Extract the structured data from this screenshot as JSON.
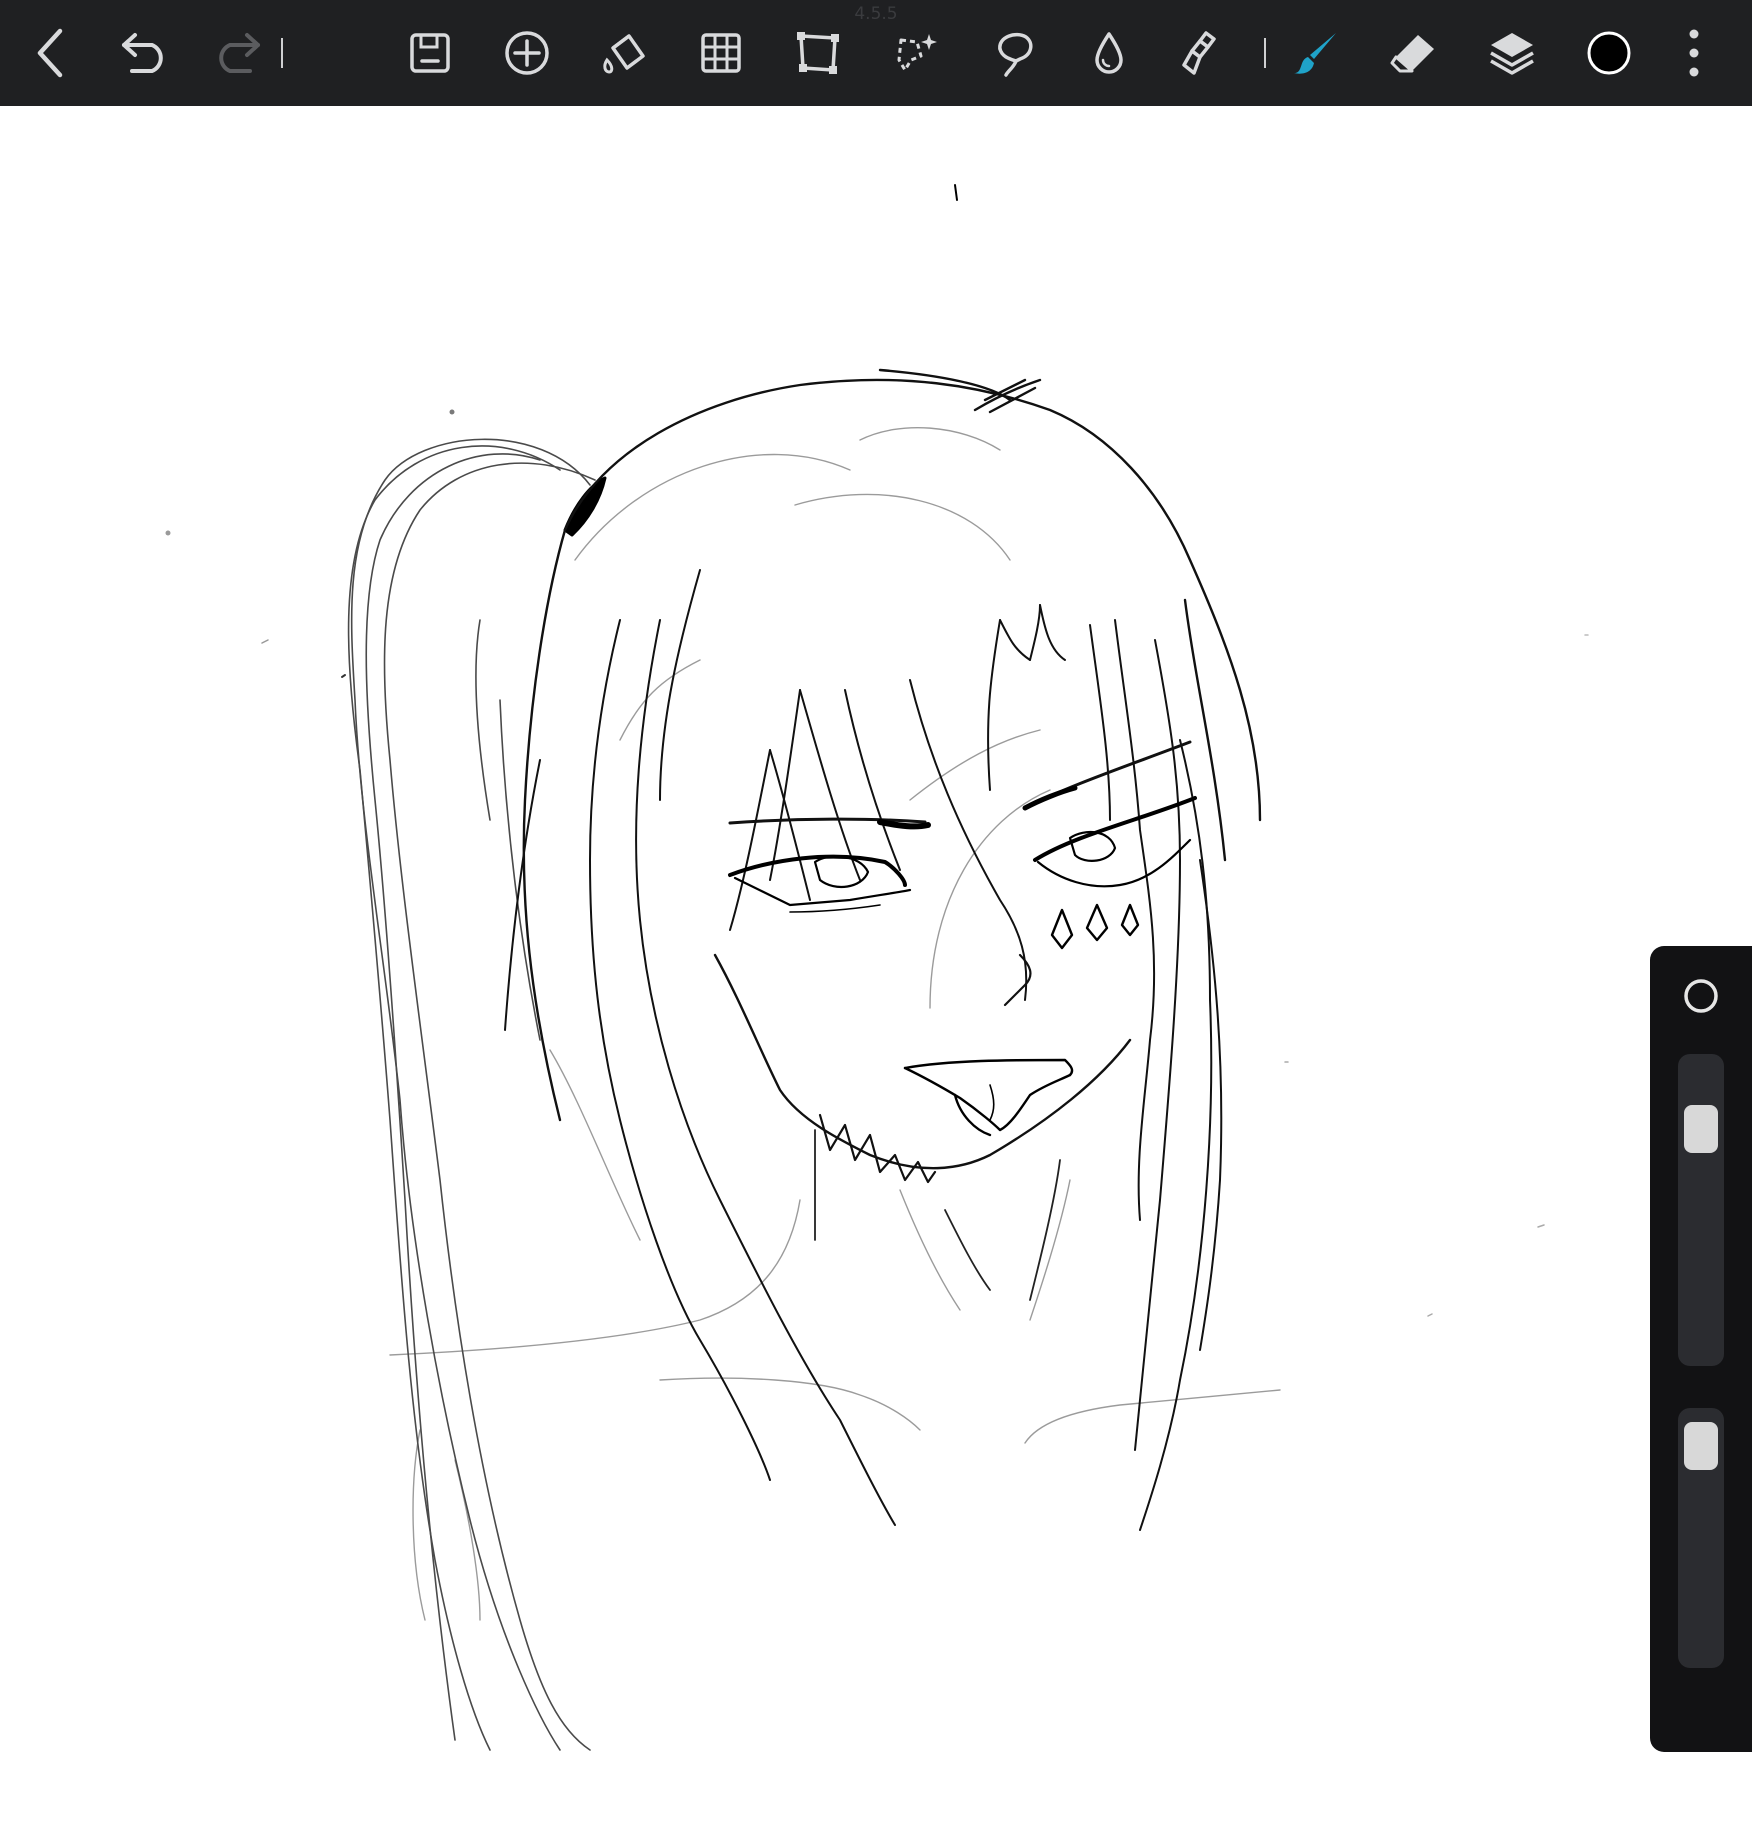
{
  "app": {
    "version": "4.5.5"
  },
  "toolbar": {
    "left_tools": [
      {
        "name": "back",
        "icon": "chevron-left-icon"
      },
      {
        "name": "undo",
        "icon": "undo-icon"
      },
      {
        "name": "redo",
        "icon": "redo-icon",
        "disabled": true
      }
    ],
    "center_tools": [
      {
        "name": "save",
        "icon": "save-icon"
      },
      {
        "name": "add",
        "icon": "add-circle-icon"
      },
      {
        "name": "fill",
        "icon": "paint-bucket-icon"
      },
      {
        "name": "grid",
        "icon": "grid-icon"
      },
      {
        "name": "transform",
        "icon": "transform-icon"
      },
      {
        "name": "magic-select",
        "icon": "magic-wand-icon"
      },
      {
        "name": "lasso",
        "icon": "lasso-icon"
      },
      {
        "name": "blur",
        "icon": "water-drop-icon"
      },
      {
        "name": "smudge",
        "icon": "smudge-icon"
      }
    ],
    "right_tools": [
      {
        "name": "brush",
        "icon": "brush-icon",
        "active": true
      },
      {
        "name": "eraser",
        "icon": "eraser-icon"
      },
      {
        "name": "layers",
        "icon": "layers-icon"
      },
      {
        "name": "color",
        "icon": "color-swatch-icon"
      },
      {
        "name": "more",
        "icon": "more-vertical-icon"
      }
    ]
  },
  "colors": {
    "toolbar_bg": "#1f2022",
    "icon": "#d9dadc",
    "icon_disabled": "#5b5c5f",
    "active_brush": "#1fa3c9",
    "current_color": "#000000",
    "panel_bg": "#121214",
    "slider_track": "#2b2c30",
    "slider_thumb": "#d8d8d8"
  },
  "side_panel": {
    "tool_icon": "circle-outline-icon",
    "brush_size_level": 0.18,
    "opacity_level": 0.04
  }
}
